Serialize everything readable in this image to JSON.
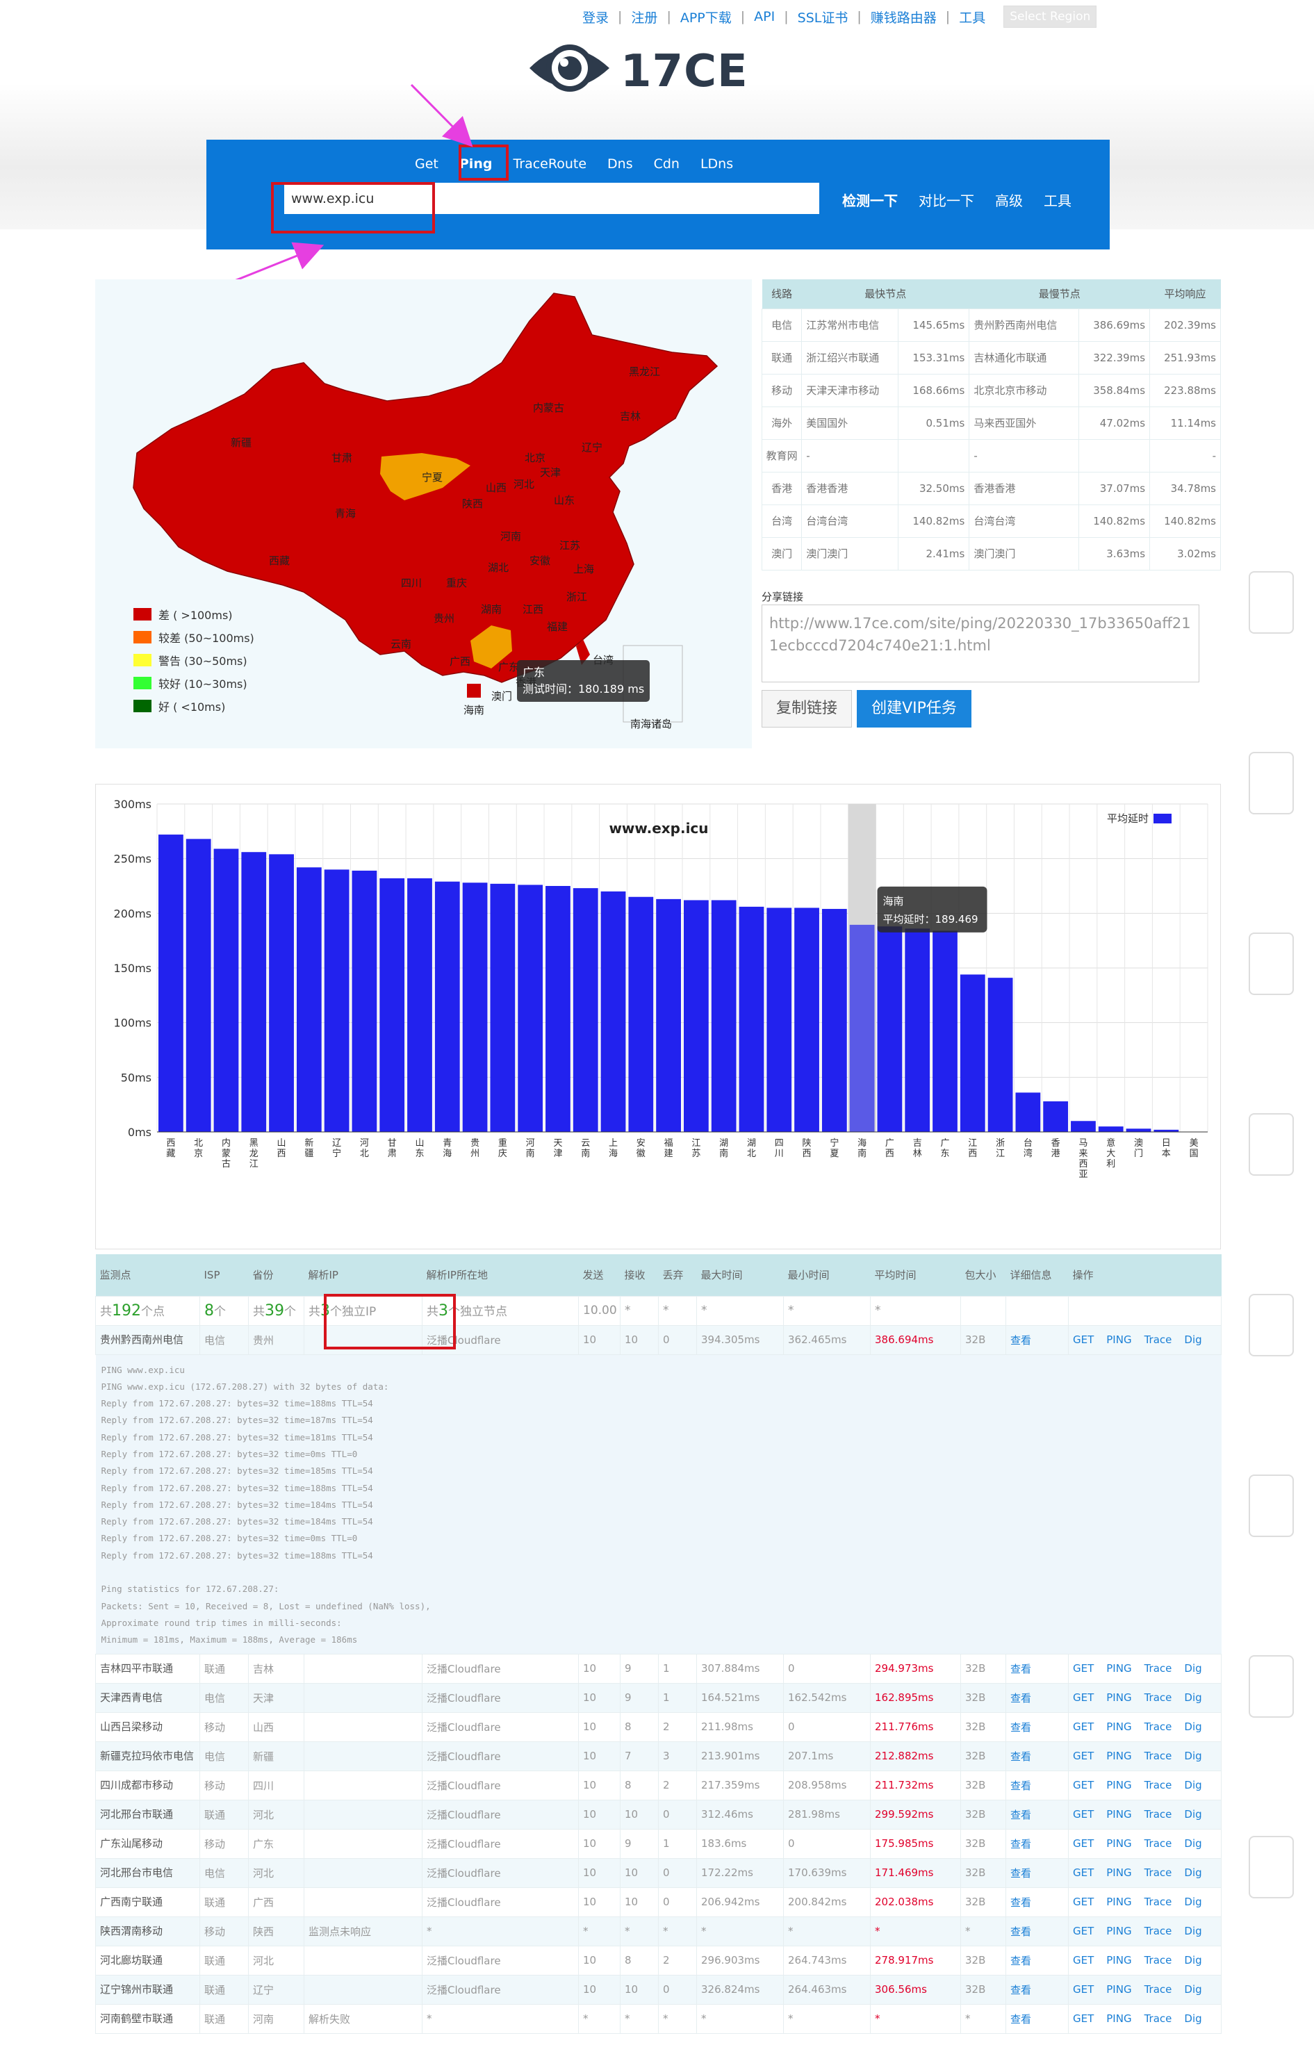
{
  "nav": {
    "items": [
      "登录",
      "注册",
      "APP下载",
      "API",
      "SSL证书",
      "赚钱路由器",
      "工具"
    ],
    "region": "Select Region"
  },
  "logo": {
    "text": "17CE"
  },
  "tabs": [
    {
      "label": "Get"
    },
    {
      "label": "Ping"
    },
    {
      "label": "TraceRoute"
    },
    {
      "label": "Dns"
    },
    {
      "label": "Cdn"
    },
    {
      "label": "LDns"
    }
  ],
  "search": {
    "value": "www.exp.icu"
  },
  "actions": {
    "detect": "检测一下",
    "compare": "对比一下",
    "advanced": "高级",
    "tools": "工具"
  },
  "map": {
    "labels": [
      "黑龙江",
      "吉林",
      "辽宁",
      "内蒙古",
      "北京",
      "天津",
      "河北",
      "山西",
      "宁夏",
      "甘肃",
      "陕西",
      "山东",
      "河南",
      "江苏",
      "安徽",
      "上海",
      "湖北",
      "浙江",
      "四川",
      "重庆",
      "湖南",
      "江西",
      "福建",
      "贵州",
      "云南",
      "广西",
      "广东",
      "海南",
      "台湾",
      "香港",
      "澳门",
      "新疆",
      "青海",
      "西藏",
      "南海诸岛"
    ],
    "legend": [
      {
        "label": "差 ( >100ms)",
        "color": "#cc0000"
      },
      {
        "label": "较差 (50~100ms)",
        "color": "#ff6600"
      },
      {
        "label": "警告 (30~50ms)",
        "color": "#ffff33"
      },
      {
        "label": "较好 (10~30ms)",
        "color": "#33ff33"
      },
      {
        "label": "好 ( <10ms)",
        "color": "#006600"
      }
    ],
    "tooltip": {
      "province": "广东",
      "label": "测试时间：180.189 ms"
    }
  },
  "stats": {
    "headers": [
      "线路",
      "最快节点",
      "最慢节点",
      "平均响应"
    ],
    "rows": [
      [
        "电信",
        "江苏常州市电信",
        "145.65ms",
        "贵州黔西南州电信",
        "386.69ms",
        "202.39ms"
      ],
      [
        "联通",
        "浙江绍兴市联通",
        "153.31ms",
        "吉林通化市联通",
        "322.39ms",
        "251.93ms"
      ],
      [
        "移动",
        "天津天津市移动",
        "168.66ms",
        "北京北京市移动",
        "358.84ms",
        "223.88ms"
      ],
      [
        "海外",
        "美国国外",
        "0.51ms",
        "马来西亚国外",
        "47.02ms",
        "11.14ms"
      ],
      [
        "教育网",
        "-",
        "",
        "-",
        "",
        "-"
      ],
      [
        "香港",
        "香港香港",
        "32.50ms",
        "香港香港",
        "37.07ms",
        "34.78ms"
      ],
      [
        "台湾",
        "台湾台湾",
        "140.82ms",
        "台湾台湾",
        "140.82ms",
        "140.82ms"
      ],
      [
        "澳门",
        "澳门澳门",
        "2.41ms",
        "澳门澳门",
        "3.63ms",
        "3.02ms"
      ]
    ]
  },
  "share": {
    "label": "分享链接",
    "url": "http://www.17ce.com/site/ping/20220330_17b33650aff211ecbcccd7204c740e21:1.html",
    "copy": "复制链接",
    "vip": "创建VIP任务"
  },
  "chart_data": {
    "type": "bar",
    "title": "www.exp.icu",
    "legend": "平均延时",
    "categories": [
      "西藏",
      "北京",
      "内蒙古",
      "黑龙江",
      "山西",
      "新疆",
      "辽宁",
      "河北",
      "甘肃",
      "山东",
      "青海",
      "贵州",
      "重庆",
      "河南",
      "天津",
      "云南",
      "上海",
      "安徽",
      "福建",
      "江苏",
      "湖南",
      "湖北",
      "四川",
      "陕西",
      "宁夏",
      "海南",
      "广西",
      "吉林",
      "广东",
      "江西",
      "浙江",
      "台湾",
      "香港",
      "马来西亚",
      "意大利",
      "澳门",
      "日本",
      "美国"
    ],
    "values": [
      272,
      268,
      259,
      256,
      254,
      242,
      240,
      239,
      232,
      232,
      229,
      228,
      227,
      226,
      225,
      223,
      220,
      215,
      213,
      212,
      212,
      206,
      205,
      205,
      204,
      189.469,
      188,
      186,
      184,
      144,
      141,
      36,
      28,
      10,
      5,
      3,
      2
    ],
    "ylim": [
      0,
      300
    ],
    "yticks": [
      "0ms",
      "50ms",
      "100ms",
      "150ms",
      "200ms",
      "250ms",
      "300ms"
    ],
    "highlight": {
      "index": 25,
      "name": "海南",
      "label": "平均延时：189.469"
    },
    "color": "#2222ee"
  },
  "results": {
    "headers": [
      "监测点",
      "ISP",
      "省份",
      "解析IP",
      "解析IP所在地",
      "发送",
      "接收",
      "丢弃",
      "最大时间",
      "最小时间",
      "平均时间",
      "包大小",
      "详细信息",
      "操作"
    ],
    "totals": {
      "nodes_pre": "共",
      "nodes": "192",
      "nodes_suf": "个点",
      "isp": "8",
      "isp_suf": "个",
      "prov_pre": "共",
      "prov": "39",
      "prov_suf": "个",
      "ip_pre": "共",
      "ip": "3",
      "ip_suf": "个独立IP",
      "loc_pre": "共",
      "loc": "3",
      "loc_suf": "个独立节点",
      "send": "10.00",
      "a": "*",
      "b": "*",
      "c": "*",
      "d": "*",
      "e": "*"
    },
    "first": [
      "贵州黔西南州电信",
      "电信",
      "贵州",
      "",
      "泛播Cloudflare",
      "10",
      "10",
      "0",
      "394.305ms",
      "362.465ms",
      "386.694ms",
      "32B",
      "查看"
    ],
    "ops": [
      "GET",
      "PING",
      "Trace",
      "Dig"
    ],
    "ping_output": "PING www.exp.icu\nPING www.exp.icu (172.67.208.27) with 32 bytes of data:\nReply from 172.67.208.27: bytes=32 time=188ms TTL=54\nReply from 172.67.208.27: bytes=32 time=187ms TTL=54\nReply from 172.67.208.27: bytes=32 time=181ms TTL=54\nReply from 172.67.208.27: bytes=32 time=0ms TTL=0\nReply from 172.67.208.27: bytes=32 time=185ms TTL=54\nReply from 172.67.208.27: bytes=32 time=188ms TTL=54\nReply from 172.67.208.27: bytes=32 time=184ms TTL=54\nReply from 172.67.208.27: bytes=32 time=184ms TTL=54\nReply from 172.67.208.27: bytes=32 time=0ms TTL=0\nReply from 172.67.208.27: bytes=32 time=188ms TTL=54\n\nPing statistics for 172.67.208.27:\nPackets: Sent = 10, Received = 8, Lost = undefined (NaN% loss),\nApproximate round trip times in milli-seconds:\nMinimum = 181ms, Maximum = 188ms, Average = 186ms",
    "rows": [
      [
        "吉林四平市联通",
        "联通",
        "吉林",
        "",
        "泛播Cloudflare",
        "10",
        "9",
        "1",
        "307.884ms",
        "0",
        "294.973ms",
        "32B",
        "查看"
      ],
      [
        "天津西青电信",
        "电信",
        "天津",
        "",
        "泛播Cloudflare",
        "10",
        "9",
        "1",
        "164.521ms",
        "162.542ms",
        "162.895ms",
        "32B",
        "查看"
      ],
      [
        "山西吕梁移动",
        "移动",
        "山西",
        "",
        "泛播Cloudflare",
        "10",
        "8",
        "2",
        "211.98ms",
        "0",
        "211.776ms",
        "32B",
        "查看"
      ],
      [
        "新疆克拉玛依市电信",
        "电信",
        "新疆",
        "",
        "泛播Cloudflare",
        "10",
        "7",
        "3",
        "213.901ms",
        "207.1ms",
        "212.882ms",
        "32B",
        "查看"
      ],
      [
        "四川成都市移动",
        "移动",
        "四川",
        "",
        "泛播Cloudflare",
        "10",
        "8",
        "2",
        "217.359ms",
        "208.958ms",
        "211.732ms",
        "32B",
        "查看"
      ],
      [
        "河北邢台市联通",
        "联通",
        "河北",
        "",
        "泛播Cloudflare",
        "10",
        "10",
        "0",
        "312.46ms",
        "281.98ms",
        "299.592ms",
        "32B",
        "查看"
      ],
      [
        "广东汕尾移动",
        "移动",
        "广东",
        "",
        "泛播Cloudflare",
        "10",
        "9",
        "1",
        "183.6ms",
        "0",
        "175.985ms",
        "32B",
        "查看"
      ],
      [
        "河北邢台市电信",
        "电信",
        "河北",
        "",
        "泛播Cloudflare",
        "10",
        "10",
        "0",
        "172.22ms",
        "170.639ms",
        "171.469ms",
        "32B",
        "查看"
      ],
      [
        "广西南宁联通",
        "联通",
        "广西",
        "",
        "泛播Cloudflare",
        "10",
        "10",
        "0",
        "206.942ms",
        "200.842ms",
        "202.038ms",
        "32B",
        "查看"
      ],
      [
        "陕西渭南移动",
        "移动",
        "陕西",
        "监测点未响应",
        "*",
        "*",
        "*",
        "*",
        "*",
        "*",
        "*",
        "*",
        "查看"
      ],
      [
        "河北廊坊联通",
        "联通",
        "河北",
        "",
        "泛播Cloudflare",
        "10",
        "8",
        "2",
        "296.903ms",
        "264.743ms",
        "278.917ms",
        "32B",
        "查看"
      ],
      [
        "辽宁锦州市联通",
        "联通",
        "辽宁",
        "",
        "泛播Cloudflare",
        "10",
        "10",
        "0",
        "326.824ms",
        "264.463ms",
        "306.56ms",
        "32B",
        "查看"
      ],
      [
        "河南鹤壁市联通",
        "联通",
        "河南",
        "解析失败",
        "*",
        "*",
        "*",
        "*",
        "*",
        "*",
        "*",
        "*",
        "查看"
      ]
    ]
  }
}
